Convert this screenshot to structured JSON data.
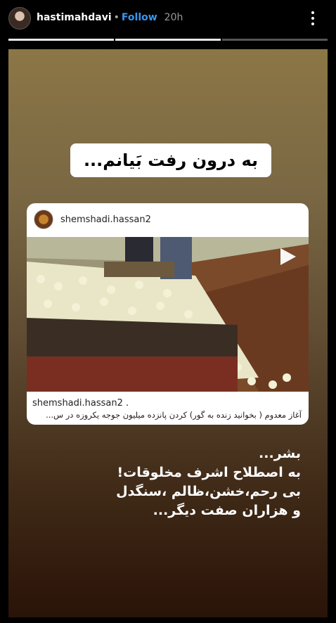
{
  "header": {
    "username": "hastimahdavi",
    "separator": "•",
    "follow_label": "Follow",
    "time": "20h",
    "more_icon": "more-vertical-icon"
  },
  "progress": {
    "segments": 3,
    "current_index": 1
  },
  "story": {
    "headline": "به درون رفت بَیانم...",
    "post_card": {
      "author": "shemshadi.hassan2",
      "caption_author": "shemshadi.hassan2 .",
      "caption": "آغاز معدوم ( بخوانید زنده به گور) کردن پانزده میلیون جوجه یکروزه در س...",
      "play_icon": "play-icon"
    },
    "poem_lines": [
      "بشر...",
      "به اصطلاح اشرف مخلوقات!",
      "بی رحم،خشن،ظالم ،سنگدل",
      "و هزاران صفت دیگر..."
    ]
  }
}
